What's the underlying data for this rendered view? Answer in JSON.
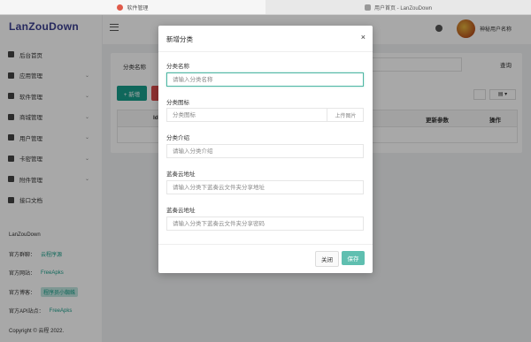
{
  "browser": {
    "tabs": [
      {
        "label": "软件管理"
      },
      {
        "label": "用户首页 - LanZouDown"
      }
    ]
  },
  "app": {
    "logo": "LanZouDown",
    "user_name": "神秘用户名称"
  },
  "sidebar": {
    "items": [
      {
        "label": "后台首页",
        "icon": "home-icon",
        "has_children": false
      },
      {
        "label": "应用管理",
        "icon": "app-icon",
        "has_children": true
      },
      {
        "label": "软件管理",
        "icon": "software-icon",
        "has_children": true
      },
      {
        "label": "商城管理",
        "icon": "shop-icon",
        "has_children": true
      },
      {
        "label": "用户管理",
        "icon": "user-icon",
        "has_children": true
      },
      {
        "label": "卡密管理",
        "icon": "card-icon",
        "has_children": true
      },
      {
        "label": "附件管理",
        "icon": "attachment-icon",
        "has_children": true
      },
      {
        "label": "接口文档",
        "icon": "doc-icon",
        "has_children": false
      }
    ],
    "info": {
      "name": "LanZouDown",
      "group_label": "官方群聊：",
      "group_value": "云程序源",
      "site_label": "官方网站：",
      "site_value": "FreeApks",
      "blog_label": "官方博客：",
      "blog_value": "程序员小蜘蛛",
      "api_label": "官方API站点：",
      "api_value": "FreeApks",
      "copyright": "Copyright © 云程 2022."
    }
  },
  "page": {
    "filter_label": "分类名称",
    "search_button": "查询",
    "add_button": "+ 新增",
    "columns": {
      "id": "Id",
      "update_params": "更新参数",
      "actions": "操作"
    }
  },
  "modal": {
    "title": "新增分类",
    "close_symbol": "×",
    "fields": {
      "name_label": "分类名称",
      "name_placeholder": "请输入分类名称",
      "icon_label": "分类图标",
      "icon_placeholder": "分类图标",
      "upload_label": "上传图片",
      "intro_label": "分类介绍",
      "intro_placeholder": "请输入分类介绍",
      "url_label": "蓝奏云地址",
      "url_placeholder": "请输入分类下蓝奏云文件夹分享地址",
      "pwd_label": "蓝奏云地址",
      "pwd_placeholder": "请输入分类下蓝奏云文件夹分享密码"
    },
    "close_button": "关闭",
    "save_button": "保存"
  },
  "colors": {
    "accent": "#179d8b",
    "save": "#5fbfb0",
    "danger": "#d84b4b",
    "logo": "#3b3f8f"
  }
}
